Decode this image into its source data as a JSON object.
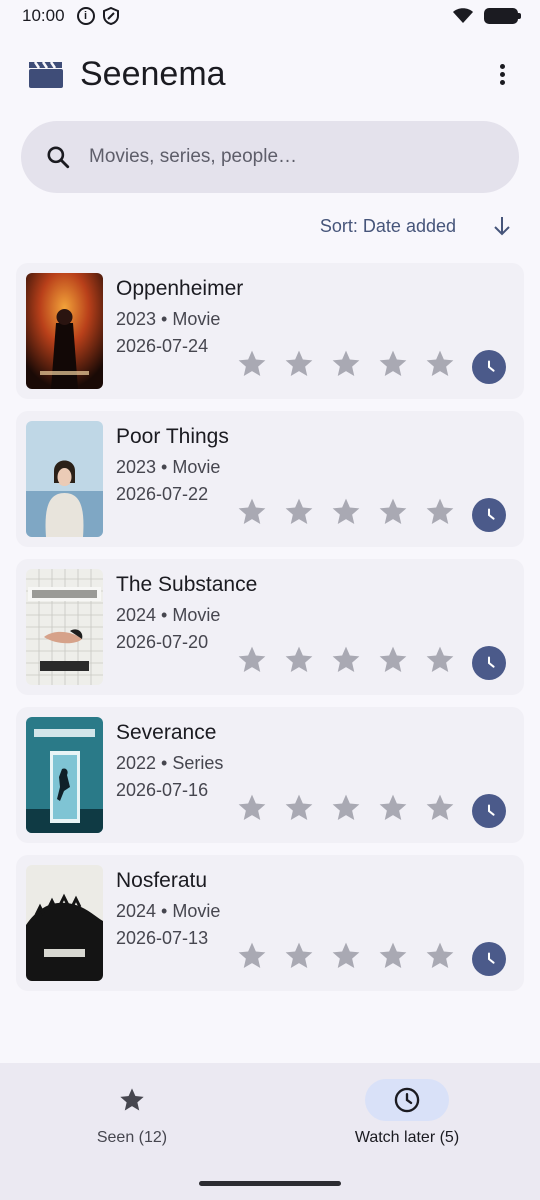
{
  "status_bar": {
    "time": "10:00",
    "icons": [
      "info-icon",
      "shield-icon",
      "wifi-icon",
      "battery-icon"
    ]
  },
  "app": {
    "title": "Seenema",
    "logo_icon": "clapperboard-icon"
  },
  "search": {
    "placeholder": "Movies, series, people…",
    "value": ""
  },
  "sort": {
    "label": "Sort: Date added",
    "direction_icon": "arrow-down-icon"
  },
  "movies": [
    {
      "title": "Oppenheimer",
      "meta": "2023 • Movie",
      "date": "2026-07-24",
      "rating": 0,
      "watch_later": true
    },
    {
      "title": "Poor Things",
      "meta": "2023 • Movie",
      "date": "2026-07-22",
      "rating": 0,
      "watch_later": true
    },
    {
      "title": "The Substance",
      "meta": "2024 • Movie",
      "date": "2026-07-20",
      "rating": 0,
      "watch_later": true
    },
    {
      "title": "Severance",
      "meta": "2022 • Series",
      "date": "2026-07-16",
      "rating": 0,
      "watch_later": true
    },
    {
      "title": "Nosferatu",
      "meta": "2024 • Movie",
      "date": "2026-07-13",
      "rating": 0,
      "watch_later": true
    }
  ],
  "bottom_nav": {
    "seen_label": "Seen (12)",
    "later_label": "Watch later (5)",
    "active": "watch_later"
  },
  "colors": {
    "accent": "#4b5a8a",
    "star_inactive": "#a9a9b3",
    "surface": "#f1f0f6"
  }
}
